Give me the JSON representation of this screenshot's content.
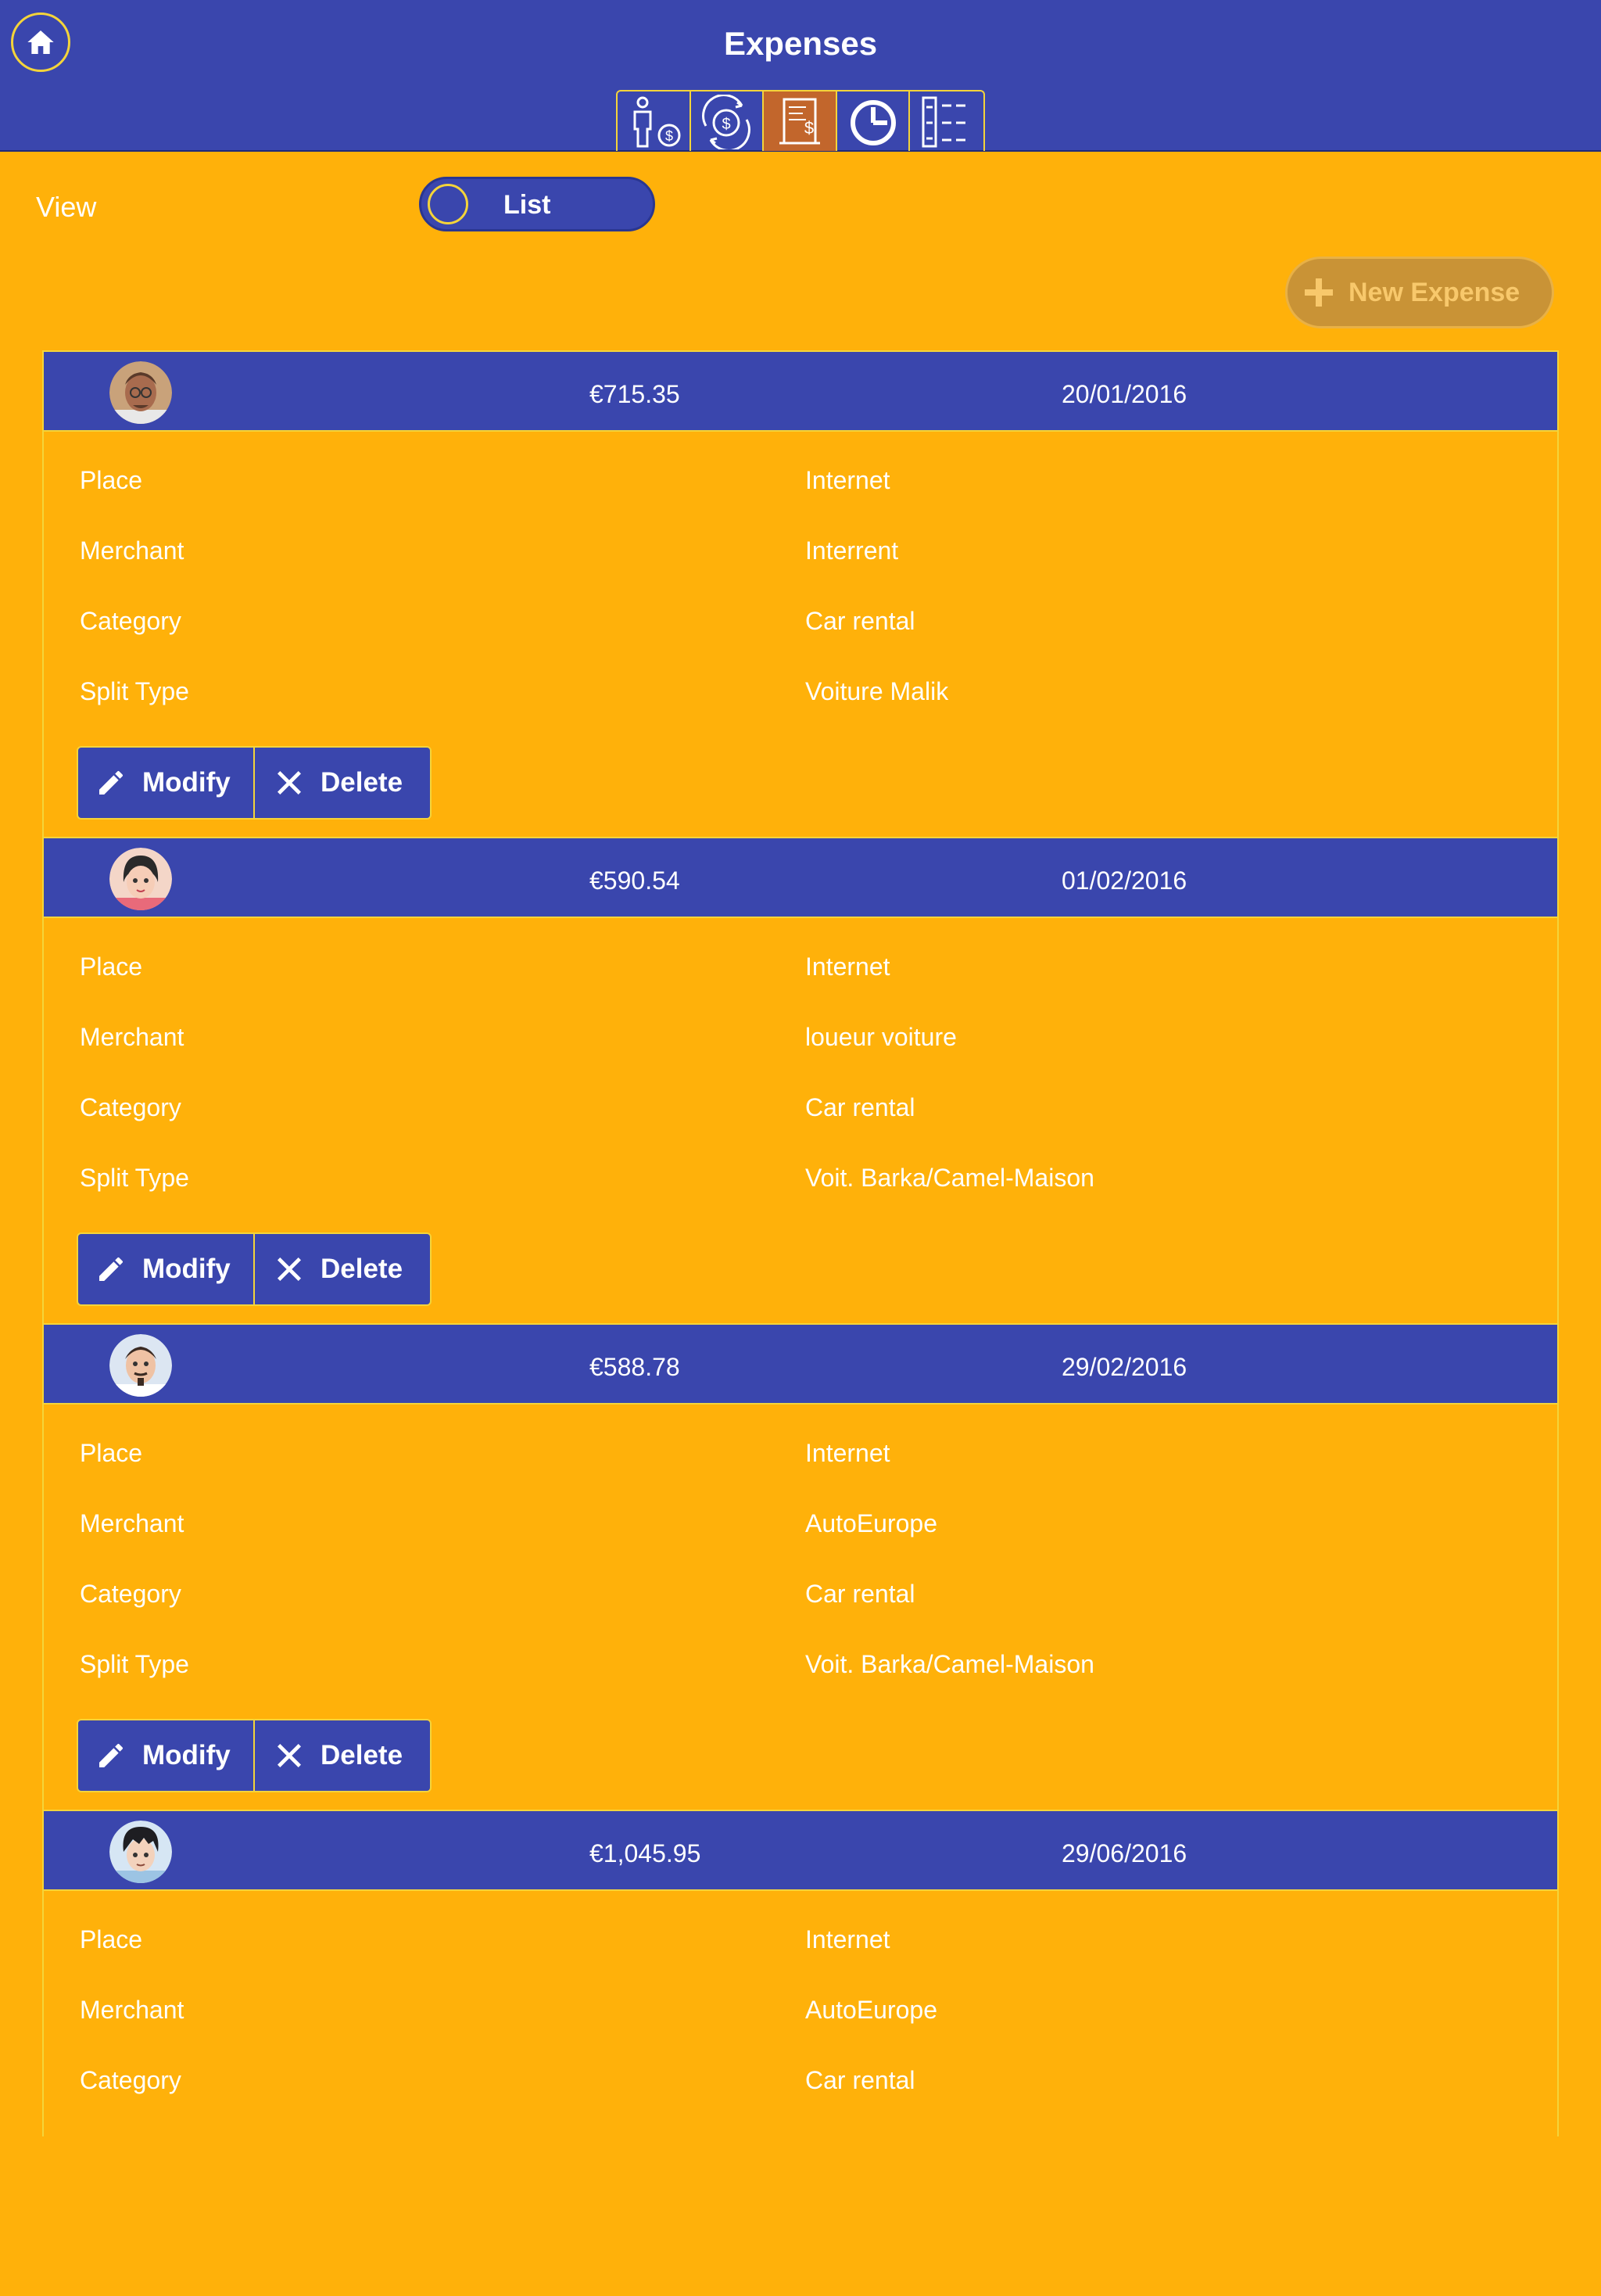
{
  "header": {
    "title": "Expenses",
    "nav_tabs": [
      {
        "icon": "person-money-icon",
        "active": false
      },
      {
        "icon": "money-exchange-icon",
        "active": false
      },
      {
        "icon": "receipt-icon",
        "active": true
      },
      {
        "icon": "pie-chart-icon",
        "active": false
      },
      {
        "icon": "checklist-icon",
        "active": false
      }
    ],
    "home_icon": "home-icon"
  },
  "view": {
    "label": "View",
    "toggle_label": "List"
  },
  "new_expense_label": "New Expense",
  "row_labels": {
    "place": "Place",
    "merchant": "Merchant",
    "category": "Category",
    "split_type": "Split Type"
  },
  "actions": {
    "modify": "Modify",
    "delete": "Delete"
  },
  "expenses": [
    {
      "amount": "€715.35",
      "date": "20/01/2016",
      "place": "Internet",
      "merchant": "Interrent",
      "category": "Car rental",
      "split_type": "Voiture Malik",
      "avatar": "man-glasses-avatar"
    },
    {
      "amount": "€590.54",
      "date": "01/02/2016",
      "place": "Internet",
      "merchant": "loueur voiture",
      "category": "Car rental",
      "split_type": "Voit. Barka/Camel-Maison",
      "avatar": "woman-avatar"
    },
    {
      "amount": "€588.78",
      "date": "29/02/2016",
      "place": "Internet",
      "merchant": "AutoEurope",
      "category": "Car rental",
      "split_type": "Voit. Barka/Camel-Maison",
      "avatar": "man-beard-avatar"
    },
    {
      "amount": "€1,045.95",
      "date": "29/06/2016",
      "place": "Internet",
      "merchant": "AutoEurope",
      "category": "Car rental",
      "split_type": "",
      "avatar": "young-man-avatar"
    }
  ],
  "colors": {
    "background": "#FFB10A",
    "header": "#3A46AD",
    "border_accent": "#F4D43A",
    "active_tab": "#C2662C",
    "new_expense_button": "#C99336"
  }
}
